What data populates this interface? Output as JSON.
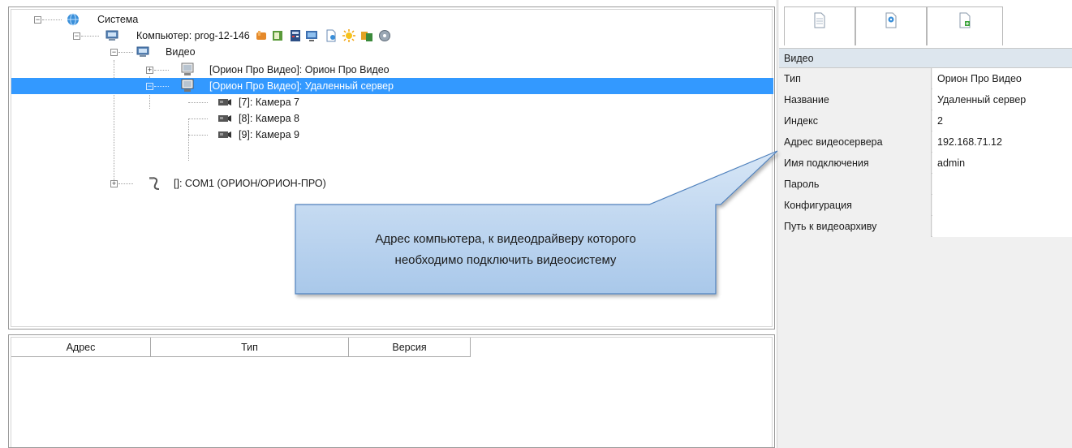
{
  "tree": {
    "root": {
      "label": "Система",
      "icon": "globe-icon"
    },
    "computer": {
      "label": "Компьютер: prog-12-146",
      "icon": "computer-icon",
      "toolbar_icons": [
        "hand-icon",
        "book-icon",
        "calculator-icon",
        "monitor-icon",
        "document-icon",
        "sun-icon",
        "keys-icon",
        "globe-disk-icon"
      ]
    },
    "video": {
      "label": "Видео",
      "icon": "computer-icon"
    },
    "video_items": [
      {
        "label": "[Орион Про Видео]: Орион Про Видео",
        "icon": "video-server-icon",
        "selected": false
      },
      {
        "label": "[Орион Про Видео]: Удаленный сервер",
        "icon": "video-server-icon",
        "selected": true
      }
    ],
    "cameras": [
      {
        "label": "[7]: Камера 7",
        "icon": "camera-icon"
      },
      {
        "label": "[8]: Камера 8",
        "icon": "camera-icon"
      },
      {
        "label": "[9]: Камера 9",
        "icon": "camera-icon"
      }
    ],
    "com": {
      "label": "[]: COM1 (ОРИОН/ОРИОН-ПРО)",
      "icon": "com-port-icon"
    }
  },
  "devices_table": {
    "columns": [
      "Адрес",
      "Тип",
      "Версия"
    ],
    "rows": []
  },
  "properties": {
    "tabs": [
      {
        "name": "document-tab",
        "icon": "document-icon"
      },
      {
        "name": "settings-tab",
        "icon": "document-gear-icon"
      },
      {
        "name": "add-tab",
        "icon": "document-add-icon"
      }
    ],
    "category": "Видео",
    "rows": [
      {
        "name": "Тип",
        "value": "Орион Про Видео"
      },
      {
        "name": "Название",
        "value": "Удаленный сервер"
      },
      {
        "name": "Индекс",
        "value": "2"
      },
      {
        "name": "Адрес видеосервера",
        "value": "192.168.71.12"
      },
      {
        "name": "Имя подключения",
        "value": "admin"
      },
      {
        "name": "Пароль",
        "value": ""
      },
      {
        "name": "Конфигурация",
        "value": ""
      },
      {
        "name": "Путь к видеоархиву",
        "value": ""
      }
    ]
  },
  "callout": {
    "line1": "Адрес компьютера, к видеодрайверу которого",
    "line2": "необходимо подключить видеосистему"
  },
  "colors": {
    "selection": "#3399ff",
    "callout_fill": "#b9d4ef",
    "callout_border": "#4f81bd",
    "category_bg": "#dde6ee"
  }
}
